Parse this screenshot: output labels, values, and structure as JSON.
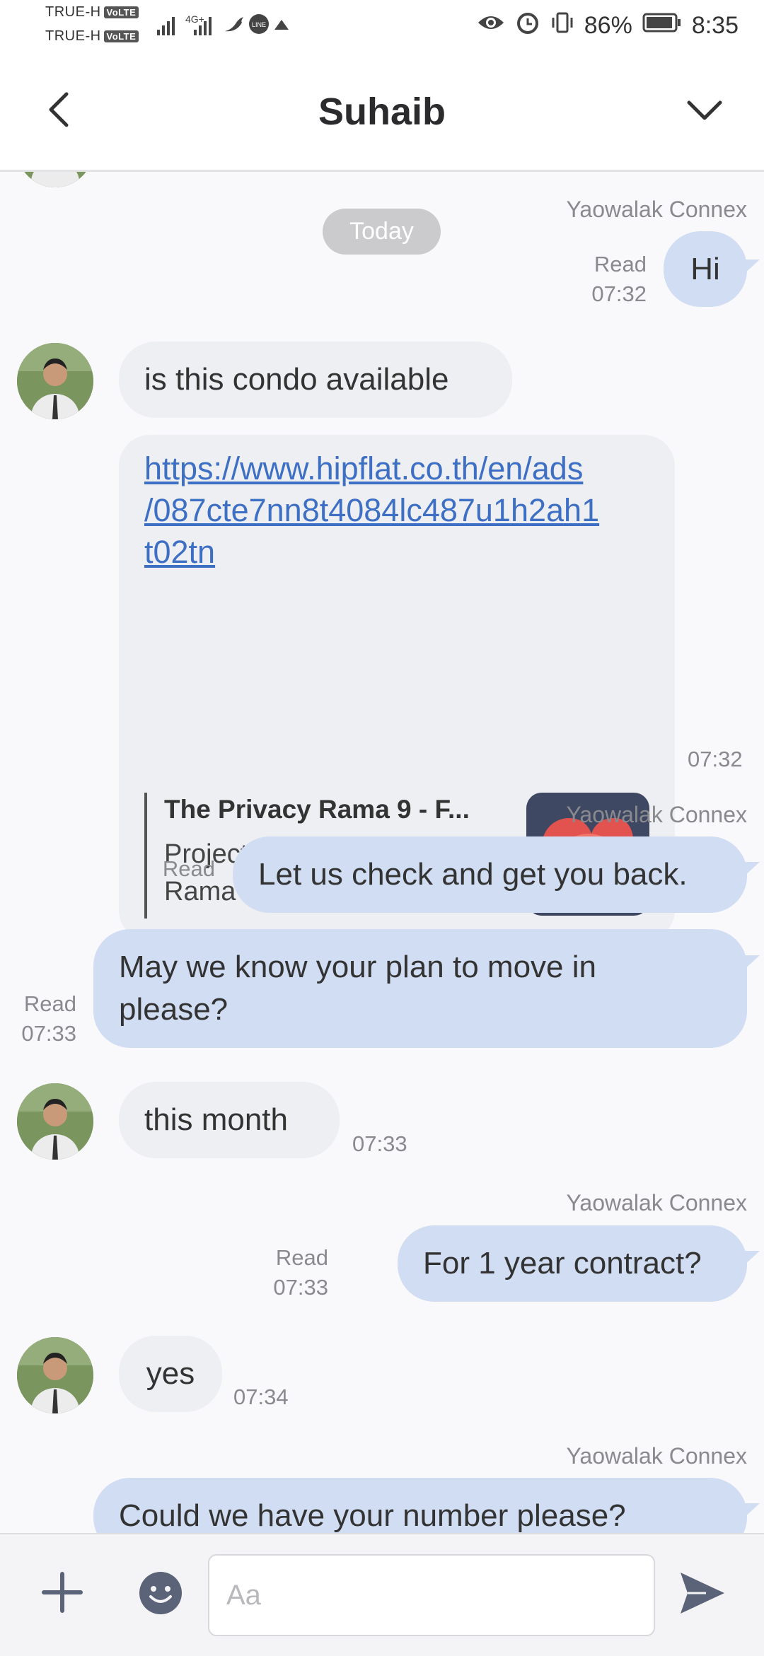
{
  "status_bar": {
    "carrier1": "TRUE-H",
    "carrier2": "TRUE-H",
    "volte": "VoLTE",
    "network": "4G+",
    "battery": "86%",
    "time": "8:35"
  },
  "header": {
    "title": "Suhaib"
  },
  "chat": {
    "date_divider": "Today",
    "messages": [
      {
        "sender": "Yaowalak Connex",
        "text": "Hi",
        "status": "Read",
        "time": "07:32"
      },
      {
        "text": "is this condo available"
      },
      {
        "link_line1": "https://www.hipflat.co.th/en/ads",
        "link_line2": "/087cte7nn8t4084lc487u1h2ah1",
        "link_line3": "t02tn",
        "preview_title": "The Privacy Rama 9 - F...",
        "preview_line1": "Project : The Privacy",
        "preview_line2": "Rama 9 Location area: ,...",
        "time": "07:32"
      },
      {
        "sender": "Yaowalak Connex",
        "text": "Let us check and get you back.",
        "status": "Read"
      },
      {
        "text_line1": "May we know your plan to move in",
        "text_line2": "please?",
        "status": "Read",
        "time": "07:33"
      },
      {
        "text": "this month",
        "time": "07:33"
      },
      {
        "sender": "Yaowalak Connex",
        "text": "For 1 year contract?",
        "status": "Read",
        "time": "07:33"
      },
      {
        "text": "yes",
        "time": "07:34"
      },
      {
        "sender": "Yaowalak Connex",
        "text": "Could we have your number please?"
      }
    ]
  },
  "input": {
    "placeholder": "Aa"
  },
  "colors": {
    "outgoing_bubble": "#d1ddf3",
    "incoming_bubble": "#eeeff2",
    "link": "#3d6fc4",
    "icon": "#5a6378"
  }
}
